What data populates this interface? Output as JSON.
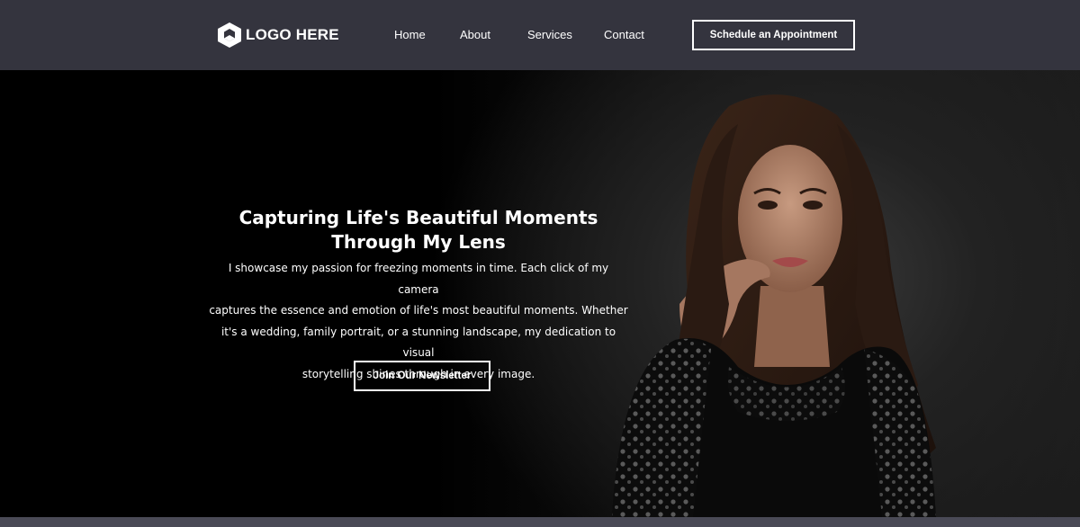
{
  "header": {
    "logo_text": "LOGO HERE",
    "logo_icon": "hexagon-logo-icon",
    "nav": [
      {
        "label": "Home"
      },
      {
        "label": "About"
      },
      {
        "label": "Services"
      },
      {
        "label": "Contact"
      }
    ],
    "cta_label": "Schedule an Appointment"
  },
  "hero": {
    "title_line1": "Capturing Life's Beautiful Moments",
    "title_line2": "Through My Lens",
    "text_lines": [
      "I showcase my passion for freezing moments in time. Each click of my camera",
      "captures the essence and emotion of life's most beautiful moments. Whether",
      "it's a wedding, family portrait, or a stunning landscape, my dedication to visual",
      "storytelling shines through in every image."
    ],
    "button_label": "Join Our Newsletter"
  },
  "colors": {
    "header_bg": "#34343e",
    "hero_bg": "#000000",
    "text": "#ffffff",
    "footer_strip": "#4a4a56"
  }
}
